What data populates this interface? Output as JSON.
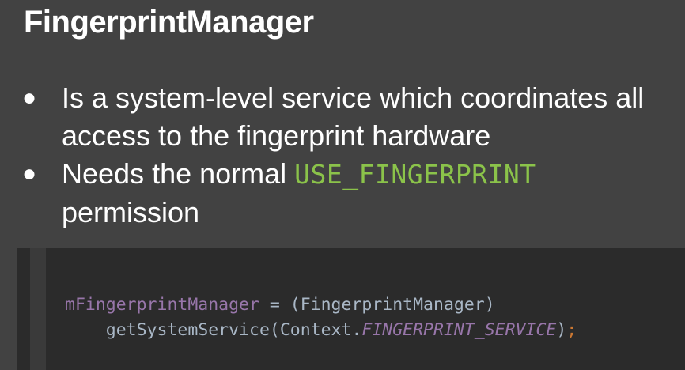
{
  "slide": {
    "title": "FingerprintManager",
    "bullets": [
      {
        "text": "Is a system-level service which coordinates all access to the fingerprint hardware"
      },
      {
        "text_before": "Needs the normal ",
        "code": "USE_FINGERPRINT",
        "text_after": " permission"
      }
    ],
    "bullet_symbol": "●"
  },
  "code_block": {
    "line1": {
      "variable": "mFingerprintManager",
      "rest": " = (FingerprintManager)"
    },
    "line2": {
      "indent": "    ",
      "call": "getSystemService(Context.",
      "constant": "FINGERPRINT_SERVICE",
      "close": ")",
      "semicolon": ";"
    }
  },
  "colors": {
    "background": "#424242",
    "code_background": "#2b2b2b",
    "inline_code": "#8bc34a",
    "code_text": "#a9b7c6",
    "code_variable": "#9876aa",
    "code_keyword": "#cc7832"
  }
}
